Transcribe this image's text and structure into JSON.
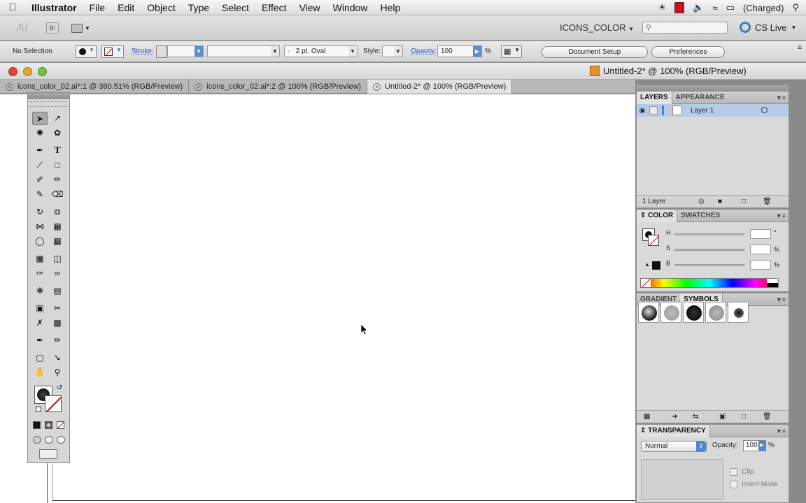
{
  "menubar": {
    "app_name": "Illustrator",
    "items": [
      "File",
      "Edit",
      "Object",
      "Type",
      "Select",
      "Effect",
      "View",
      "Window",
      "Help"
    ],
    "battery": "(Charged)"
  },
  "appbar": {
    "logo": "Ai",
    "bridge": "Br",
    "workspace": "ICONS_COLOR",
    "cs_live": "CS Live"
  },
  "control": {
    "selection": "No Selection",
    "stroke_label": "Stroke:",
    "brush": "2 pt. Oval",
    "style_label": "Style:",
    "opacity_label": "Opacity:",
    "opacity_value": "100",
    "opacity_unit": "%",
    "doc_setup": "Document Setup",
    "preferences": "Preferences"
  },
  "window": {
    "title": "Untitled-2* @ 100% (RGB/Preview)",
    "tabs": [
      "icons_color_02.ai*:1 @ 390.51% (RGB/Preview)",
      "icons_color_02.ai*:2 @ 100% (RGB/Preview)",
      "Untitled-2* @ 100% (RGB/Preview)"
    ]
  },
  "layers_panel": {
    "tabs": [
      "LAYERS",
      "APPEARANCE"
    ],
    "layer_name": "Layer 1",
    "count": "1 Layer"
  },
  "color_panel": {
    "tabs": [
      "COLOR",
      "SWATCHES"
    ],
    "h": "H",
    "s": "S",
    "b": "B",
    "deg": "°",
    "pct": "%"
  },
  "symbols_panel": {
    "tabs": [
      "GRADIENT",
      "SYMBOLS"
    ]
  },
  "transparency_panel": {
    "title": "TRANSPARENCY",
    "mode": "Normal",
    "opacity_label": "Opacity:",
    "opacity_value": "100",
    "pct": "%",
    "clip": "Clip",
    "invert": "Invert Mask"
  },
  "colors": {
    "selection_blue": "#b7cbe6",
    "accent_blue": "#3a7ec0"
  }
}
